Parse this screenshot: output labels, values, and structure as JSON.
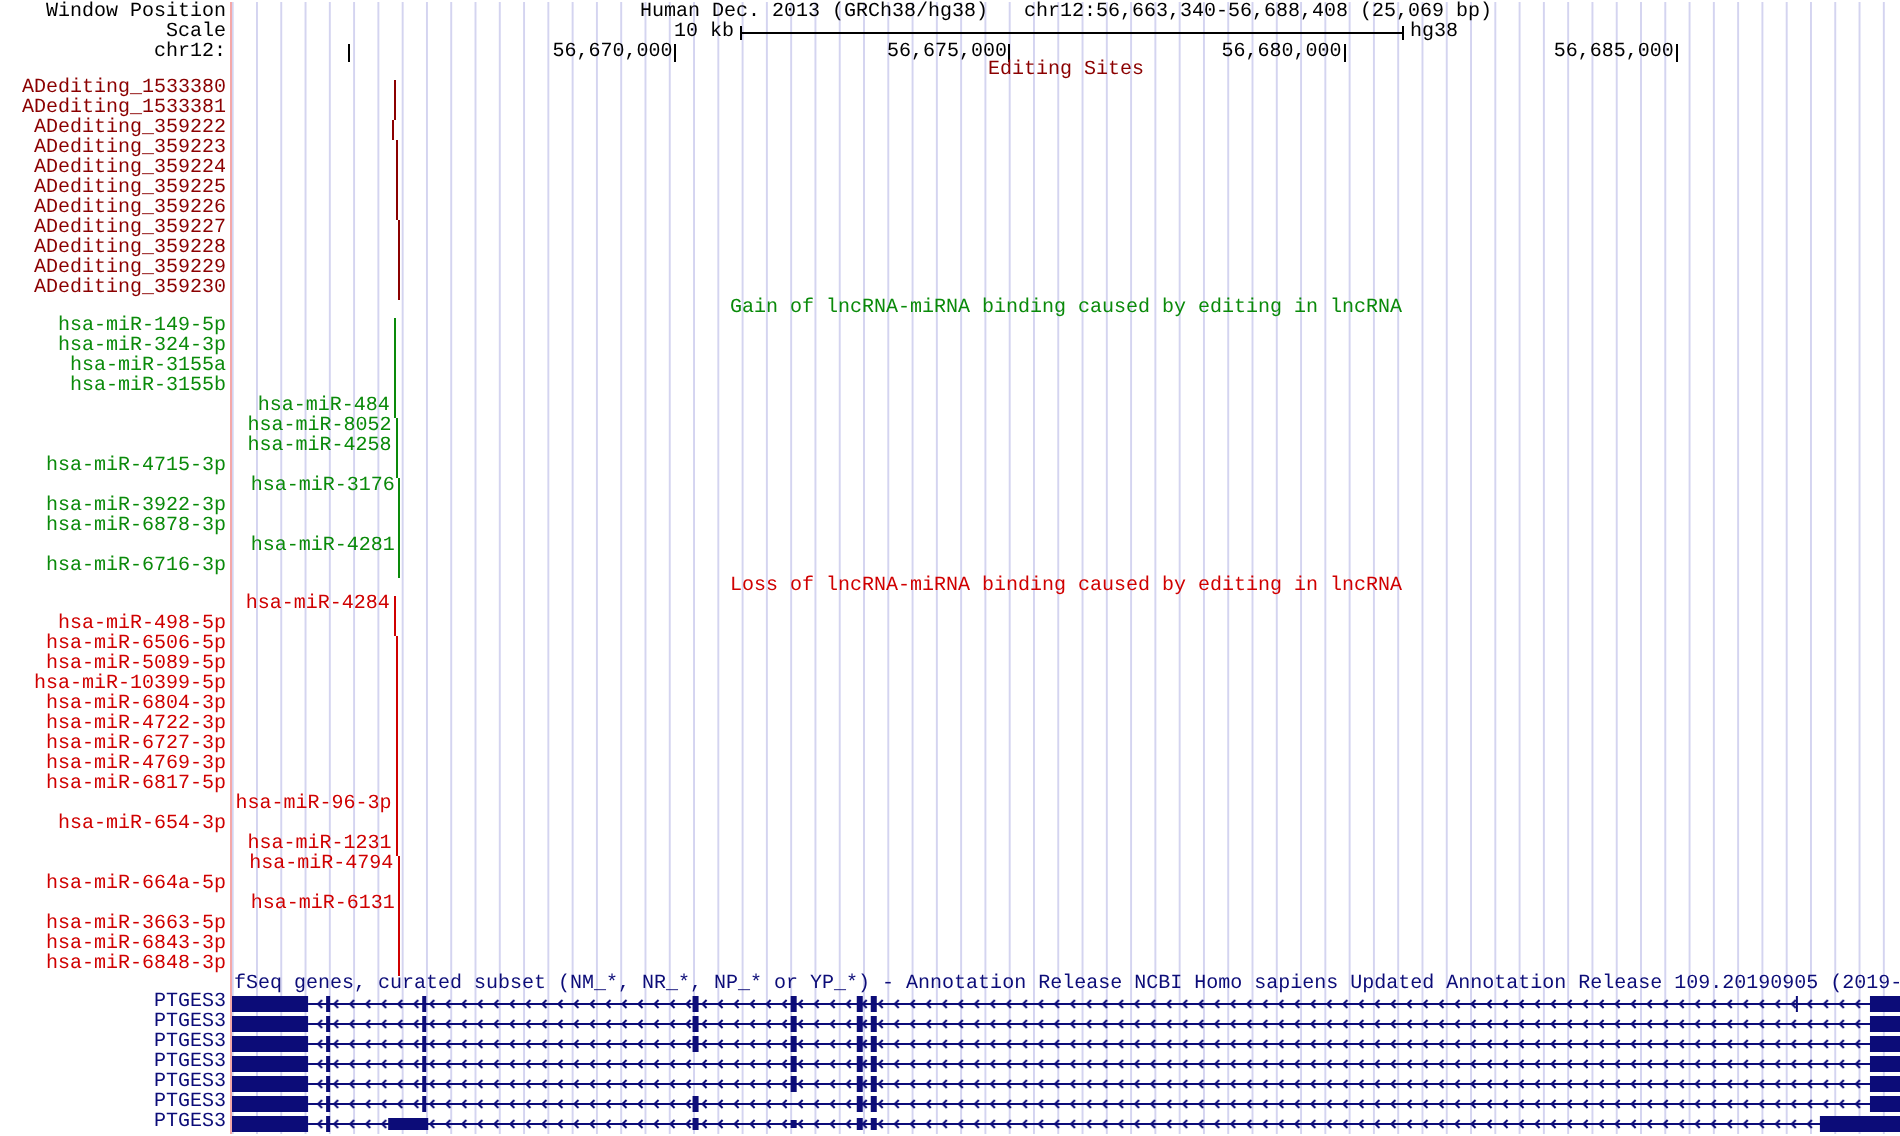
{
  "ruler": {
    "position_label": "Window Position",
    "assembly": "Human Dec. 2013 (GRCh38/hg38)",
    "position": "chr12:56,663,340-56,688,408 (25,069 bp)",
    "scale_label": "Scale",
    "scale": "10 kb",
    "database": "hg38",
    "chromosome": "chr12:",
    "ticks": [
      {
        "level": 0.0696
      },
      {
        "label": "56,670,000",
        "level": 0.2653
      },
      {
        "label": "56,675,000",
        "level": 0.4658
      },
      {
        "label": "56,680,000",
        "level": 0.6663
      },
      {
        "label": "56,685,000",
        "level": 0.8656
      }
    ]
  },
  "tracks": [
    {
      "kind": "features",
      "title": "Editing Sites",
      "color": "#8b0000",
      "items": [
        {
          "label": "ADediting_1533380",
          "kind": "left",
          "level": 0.097
        },
        {
          "label": "ADediting_1533381",
          "kind": "left",
          "level": 0.097
        },
        {
          "label": "ADediting_359222",
          "kind": "left",
          "level": 0.096
        },
        {
          "label": "ADediting_359223",
          "kind": "left",
          "level": 0.098
        },
        {
          "label": "ADediting_359224",
          "kind": "left",
          "level": 0.098
        },
        {
          "label": "ADediting_359225",
          "kind": "left",
          "level": 0.098
        },
        {
          "label": "ADediting_359226",
          "kind": "left",
          "level": 0.098
        },
        {
          "label": "ADediting_359227",
          "kind": "left",
          "level": 0.099
        },
        {
          "label": "ADediting_359228",
          "kind": "left",
          "level": 0.1
        },
        {
          "label": "ADediting_359229",
          "kind": "left",
          "level": 0.1
        },
        {
          "label": "ADediting_359230",
          "kind": "left",
          "level": 0.1
        }
      ]
    },
    {
      "kind": "features",
      "title": "Gain of lncRNA-miRNA binding caused by editing in lncRNA",
      "color": "#0a8a0a",
      "items": [
        {
          "label": "hsa-miR-149-5p",
          "kind": "left",
          "level": 0.097
        },
        {
          "label": "hsa-miR-324-3p",
          "kind": "left",
          "level": 0.097
        },
        {
          "label": "hsa-miR-3155a",
          "kind": "left",
          "level": 0.097
        },
        {
          "label": "hsa-miR-3155b",
          "kind": "left",
          "level": 0.097
        },
        {
          "label": "hsa-miR-484",
          "kind": "inline",
          "level": 0.097
        },
        {
          "label": "hsa-miR-8052",
          "kind": "inline",
          "level": 0.098
        },
        {
          "label": "hsa-miR-4258",
          "kind": "inline",
          "level": 0.098
        },
        {
          "label": "hsa-miR-4715-3p",
          "kind": "left",
          "level": 0.098
        },
        {
          "label": "hsa-miR-3176",
          "kind": "inline",
          "level": 0.1
        },
        {
          "label": "hsa-miR-3922-3p",
          "kind": "left",
          "level": 0.1
        },
        {
          "label": "hsa-miR-6878-3p",
          "kind": "left",
          "level": 0.1
        },
        {
          "label": "hsa-miR-4281",
          "kind": "inline",
          "level": 0.1
        },
        {
          "label": "hsa-miR-6716-3p",
          "kind": "left",
          "level": 0.1
        }
      ]
    },
    {
      "kind": "features",
      "title": "Loss of lncRNA-miRNA binding caused by editing in lncRNA",
      "color": "#d00000",
      "items": [
        {
          "label": "hsa-miR-4284",
          "kind": "inline",
          "level": 0.097
        },
        {
          "label": "hsa-miR-498-5p",
          "kind": "left",
          "level": 0.097
        },
        {
          "label": "hsa-miR-6506-5p",
          "kind": "left",
          "level": 0.098
        },
        {
          "label": "hsa-miR-5089-5p",
          "kind": "left",
          "level": 0.098
        },
        {
          "label": "hsa-miR-10399-5p",
          "kind": "left",
          "level": 0.098
        },
        {
          "label": "hsa-miR-6804-3p",
          "kind": "left",
          "level": 0.098
        },
        {
          "label": "hsa-miR-4722-3p",
          "kind": "left",
          "level": 0.098
        },
        {
          "label": "hsa-miR-6727-3p",
          "kind": "left",
          "level": 0.098
        },
        {
          "label": "hsa-miR-4769-3p",
          "kind": "left",
          "level": 0.098
        },
        {
          "label": "hsa-miR-6817-5p",
          "kind": "left",
          "level": 0.098
        },
        {
          "label": "hsa-miR-96-3p",
          "kind": "inline",
          "level": 0.098
        },
        {
          "label": "hsa-miR-654-3p",
          "kind": "left",
          "level": 0.098
        },
        {
          "label": "hsa-miR-1231",
          "kind": "inline",
          "level": 0.098
        },
        {
          "label": "hsa-miR-4794",
          "kind": "inline",
          "level": 0.099
        },
        {
          "label": "hsa-miR-664a-5p",
          "kind": "left",
          "level": 0.099
        },
        {
          "label": "hsa-miR-6131",
          "kind": "inline",
          "level": 0.1
        },
        {
          "label": "hsa-miR-3663-5p",
          "kind": "left",
          "level": 0.1
        },
        {
          "label": "hsa-miR-6843-3p",
          "kind": "left",
          "level": 0.1
        },
        {
          "label": "hsa-miR-6848-3p",
          "kind": "left",
          "level": 0.1
        }
      ]
    },
    {
      "kind": "genes",
      "title": "fSeq genes, curated subset (NM_*, NR_*, NP_* or YP_*) - Annotation Release NCBI Homo sapiens Updated Annotation Release 109.20190905 (2019-",
      "color": "#0c0c78",
      "items": [
        {
          "label": "PTGES3"
        },
        {
          "label": "PTGES3"
        },
        {
          "label": "PTGES3"
        },
        {
          "label": "PTGES3"
        },
        {
          "label": "PTGES3"
        },
        {
          "label": "PTGES3"
        },
        {
          "label": "PTGES3"
        }
      ]
    }
  ]
}
